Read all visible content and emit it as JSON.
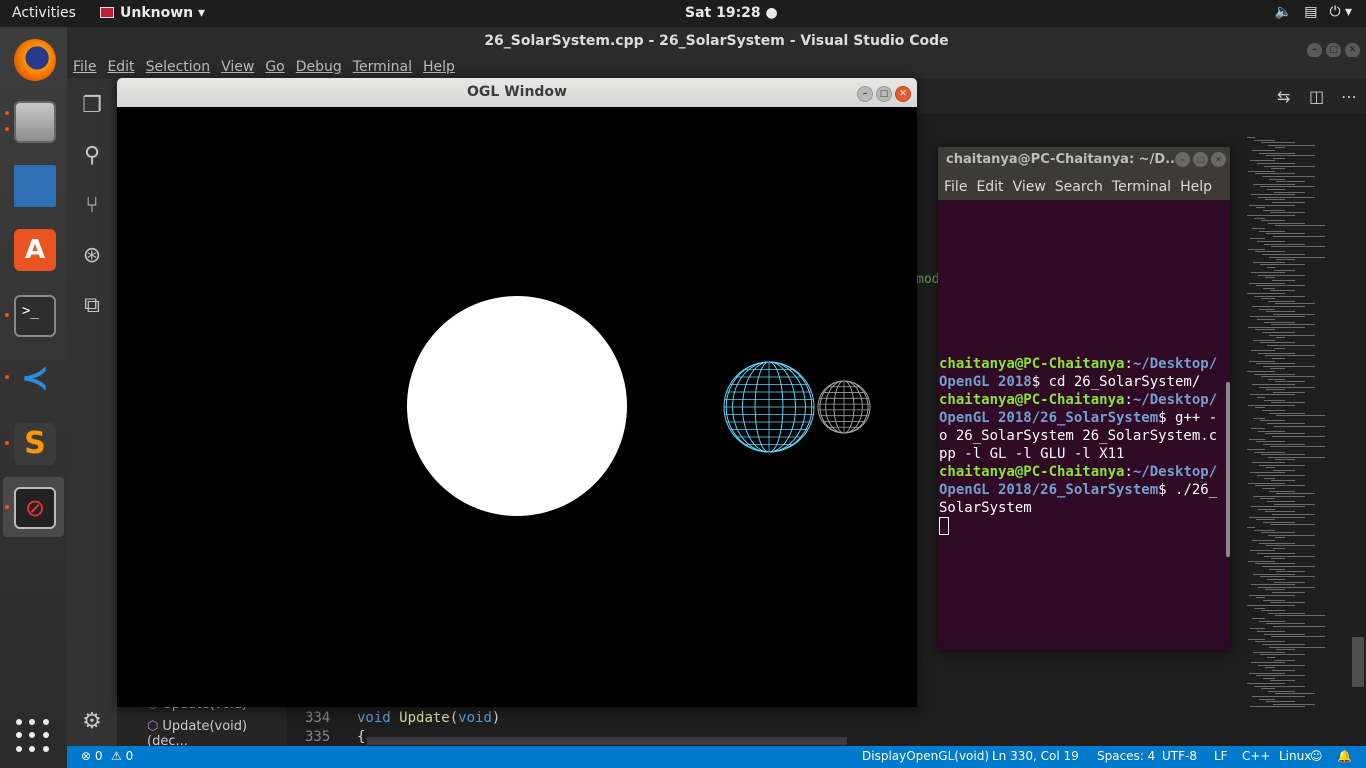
{
  "topbar": {
    "activities": "Activities",
    "app_name": "Unknown",
    "clock": "Sat 19:28 ●"
  },
  "dock": {
    "items": [
      {
        "name": "firefox-icon"
      },
      {
        "name": "files-icon"
      },
      {
        "name": "libreoffice-writer-icon"
      },
      {
        "name": "software-store-icon",
        "glyph": "A"
      },
      {
        "name": "terminal-icon",
        "glyph": ">_"
      },
      {
        "name": "vscode-icon",
        "glyph": "≺"
      },
      {
        "name": "sublime-text-icon",
        "glyph": "S"
      },
      {
        "name": "ogl-app-icon",
        "glyph": "⊘"
      }
    ]
  },
  "vscode": {
    "title": "26_SolarSystem.cpp - 26_SolarSystem - Visual Studio Code",
    "menu": [
      "File",
      "Edit",
      "Selection",
      "View",
      "Go",
      "Debug",
      "Terminal",
      "Help"
    ],
    "mod_text": "mod",
    "outline": [
      "Update(void)",
      "Update(void) (dec..."
    ],
    "code": [
      {
        "line": "334",
        "text_kw": "void",
        "text_fn": "Update",
        "text_paren1": "(",
        "text_kw2": "void",
        "text_paren2": ")"
      },
      {
        "line": "335",
        "text": "{"
      }
    ],
    "status": {
      "errors": "⊗ 0",
      "warnings": "⚠ 0",
      "function": "DisplayOpenGL(void)",
      "position": "Ln 330, Col 19",
      "spaces": "Spaces: 4",
      "encoding": "UTF-8",
      "eol": "LF",
      "language": "C++",
      "platform": "Linux"
    },
    "colors": {
      "statusbar": "#007acc",
      "editor_bg": "#1e1e1e"
    }
  },
  "ogl_window": {
    "title": "OGL Window",
    "colors": {
      "sun": "#ffffff",
      "earth": "#5fd7ff",
      "moon": "#a0a0a0"
    }
  },
  "terminal": {
    "title": "chaitanya@PC-Chaitanya: ~/D...",
    "menu": [
      "File",
      "Edit",
      "View",
      "Search",
      "Terminal",
      "Help"
    ],
    "lines": [
      {
        "user": "chaitanya@PC-Chaitanya",
        "path": "~/Desktop/OpenGL 2018",
        "cmd": "$ cd 26_SolarSystem/"
      },
      {
        "user": "chaitanya@PC-Chaitanya",
        "path": "~/Desktop/OpenGL 2018/26_SolarSystem",
        "cmd": "$ g++ -o 26_SolarSystem 26_SolarSystem.cpp -l GL -l GLU -l X11"
      },
      {
        "user": "chaitanya@PC-Chaitanya",
        "path": "~/Desktop/OpenGL 2018/26_SolarSystem",
        "cmd": "$ ./26_SolarSystem"
      }
    ],
    "colors": {
      "bg": "#300a24",
      "user": "#8ae234",
      "path": "#729fcf"
    }
  }
}
